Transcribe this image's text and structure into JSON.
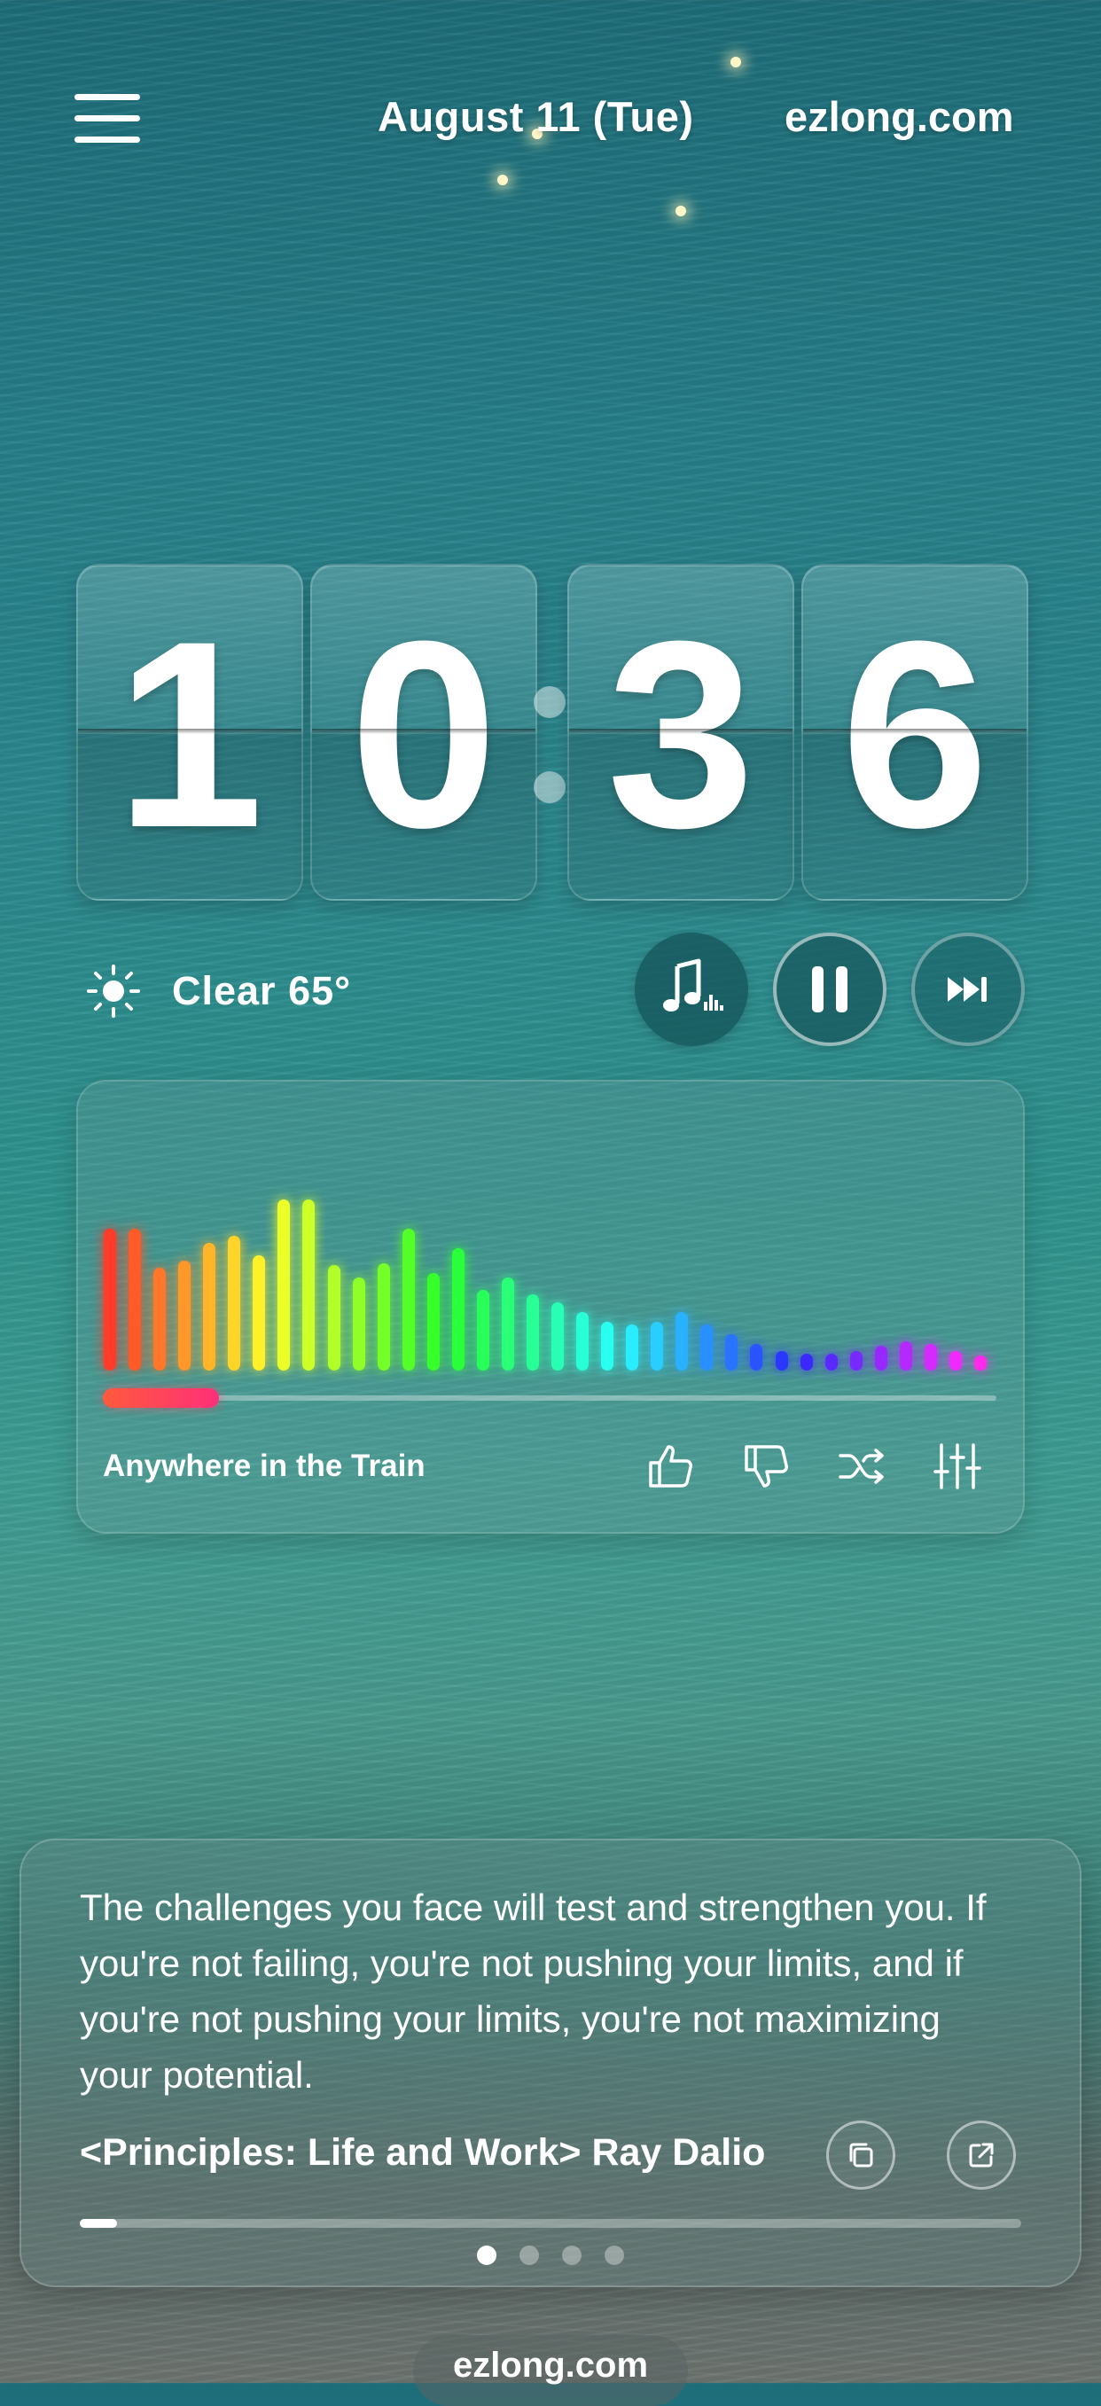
{
  "header": {
    "date": "August 11 (Tue)",
    "site": "ezlong.com"
  },
  "clock": {
    "digits": [
      "1",
      "0",
      "3",
      "6"
    ]
  },
  "weather": {
    "text": "Clear  65°",
    "icon": "sun-icon"
  },
  "player": {
    "buttons": [
      "music-library-icon",
      "pause-icon",
      "skip-next-icon"
    ],
    "track_title": "Anywhere in the Train",
    "progress": 0.13,
    "actions": [
      "thumbs-up-icon",
      "thumbs-down-icon",
      "shuffle-icon",
      "equalizer-settings-icon"
    ],
    "visualizer_levels": [
      0.58,
      0.58,
      0.42,
      0.45,
      0.52,
      0.55,
      0.47,
      0.7,
      0.7,
      0.43,
      0.38,
      0.44,
      0.58,
      0.4,
      0.5,
      0.33,
      0.38,
      0.31,
      0.28,
      0.24,
      0.2,
      0.19,
      0.2,
      0.24,
      0.19,
      0.15,
      0.11,
      0.08,
      0.07,
      0.07,
      0.08,
      0.1,
      0.12,
      0.11,
      0.08,
      0.06
    ]
  },
  "quote": {
    "text": "The challenges you face will test and strengthen you. If you're not failing, you're not pushing your limits, and if you're not pushing your limits, you're not maximizing your potential.",
    "source": "<Principles: Life and Work> Ray Dalio",
    "progress": 0.04,
    "page_count": 4,
    "active_page": 1
  },
  "footer": {
    "site": "ezlong.com"
  },
  "colors": {
    "accent_progress": "#ff3f6c",
    "button_bg": "#1a5a5f"
  }
}
